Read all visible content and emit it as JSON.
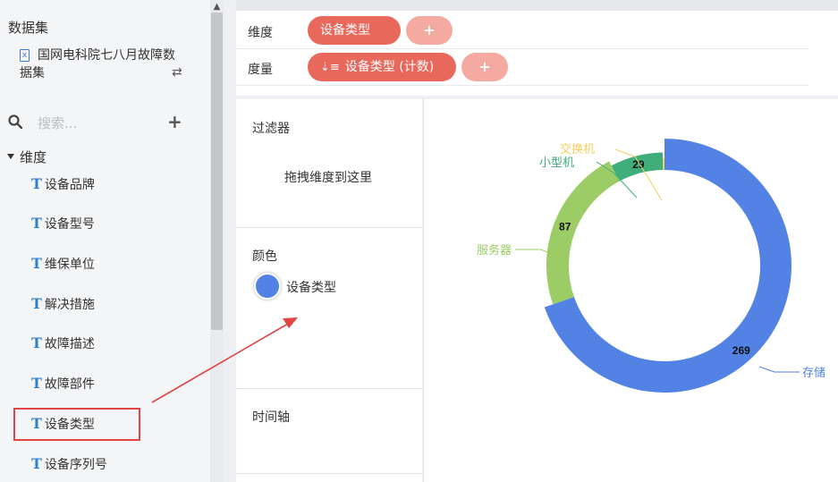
{
  "sidebar": {
    "dataset_title": "数据集",
    "dataset_name_line1": "国网电科院七八月故障数",
    "dataset_name_line2": "据集",
    "search_placeholder": "搜索...",
    "dimension_header": "维度",
    "fields": [
      {
        "label": "设备品牌",
        "type_icon": "T"
      },
      {
        "label": "设备型号",
        "type_icon": "T"
      },
      {
        "label": "维保单位",
        "type_icon": "T"
      },
      {
        "label": "解决措施",
        "type_icon": "T"
      },
      {
        "label": "故障描述",
        "type_icon": "T"
      },
      {
        "label": "故障部件",
        "type_icon": "T"
      },
      {
        "label": "设备类型",
        "type_icon": "T"
      },
      {
        "label": "设备序列号",
        "type_icon": "T"
      }
    ]
  },
  "shelves": {
    "dimension_label": "维度",
    "dimension_pill": "设备类型",
    "measure_label": "度量",
    "measure_pill": "设备类型 (计数)",
    "add_symbol": "+"
  },
  "panels": {
    "filter_title": "过滤器",
    "filter_hint": "拖拽维度到这里",
    "color_title": "颜色",
    "color_field": "设备类型",
    "color_dot": "#5282e3",
    "timeline_title": "时间轴"
  },
  "chart_data": {
    "type": "pie",
    "variant": "donut",
    "series": [
      {
        "name": "存储",
        "value": 269,
        "color": "#5282e3"
      },
      {
        "name": "服务器",
        "value": 87,
        "color": "#9ccc65"
      },
      {
        "name": "小型机",
        "value": 29,
        "color": "#3fae7a"
      },
      {
        "name": "交换机",
        "value": 1,
        "color": "#f9cc5e"
      }
    ]
  },
  "colors": {
    "accent": "#e8695c",
    "accent_light": "#f4aaa1",
    "highlight": "#e04545"
  }
}
